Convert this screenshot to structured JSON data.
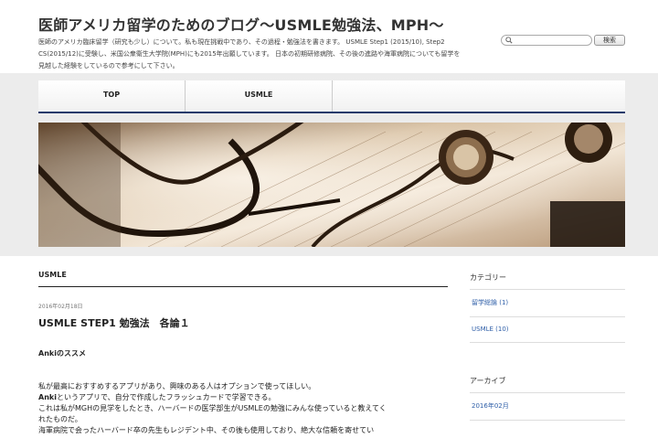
{
  "site": {
    "title": "医師アメリカ留学のためのブログ〜USMLE勉強法、MPH〜",
    "description": "医師のアメリカ臨床留学（研究も少し）について。私も現在挑戦中であり、その過程・勉強法を書きます。 USMLE Step1 (2015/10), Step2 CS(2015/12)に受験し、米国公衆衛生大学院(MPH)にも2015年出願しています。 日本の初期研修病院、その後の進路や海軍病院についても留学を見越した経験をしているので参考にして下さい。"
  },
  "search": {
    "placeholder": "",
    "button_label": "検索"
  },
  "nav": {
    "items": [
      {
        "label": "TOP"
      },
      {
        "label": "USMLE"
      }
    ]
  },
  "main": {
    "breadcrumb": "USMLE",
    "post": {
      "date": "2016年02月18日",
      "title": "USMLE STEP1 勉強法　各論１",
      "lines": {
        "l1": "Ankiのススメ",
        "l2": "私が最高におすすめするアプリがあり、興味のある人はオプションで使ってほしい。",
        "l3_bold": "Anki",
        "l3_rest": "というアプリで、自分で作成したフラッシュカードで学習できる。",
        "l4": "これは私がMGHの見学をしたとき、ハーバードの医学部生がUSMLEの勉強にみんな使っていると教えてく",
        "l5": "れたものだ。",
        "l6": "海軍病院で会ったハーバード卒の先生もレジデント中、その後も使用しており、絶大な信頼を寄せてい"
      }
    }
  },
  "sidebar": {
    "categories": {
      "heading": "カテゴリー",
      "items": [
        {
          "label": "留学総論 (1)"
        },
        {
          "label": "USMLE (10)"
        }
      ]
    },
    "archive": {
      "heading": "アーカイブ",
      "items": [
        {
          "label": "2016年02月"
        }
      ]
    }
  },
  "colors": {
    "nav_underline": "#1e3a6b",
    "link": "#2f5fa8",
    "band": "#ececec"
  }
}
